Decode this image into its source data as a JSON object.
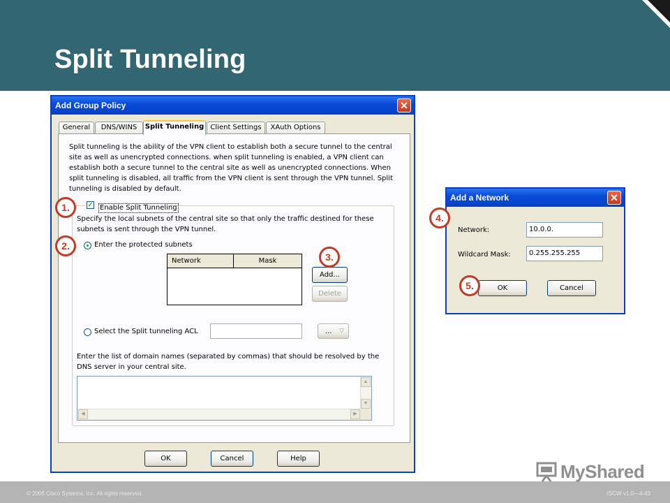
{
  "slide": {
    "title": "Split Tunneling",
    "footer_left": "© 2006 Cisco Systems, Inc. All rights reserved.",
    "footer_right": "ISCW v1.0—4-43",
    "logo_text": "MyShared",
    "colors": {
      "header": "#336673",
      "footer": "#b4b4b4",
      "marker": "#c13b26"
    }
  },
  "group_policy_dialog": {
    "title": "Add Group Policy",
    "tabs": [
      "General",
      "DNS/WINS",
      "Split Tunneling",
      "Client Settings",
      "XAuth Options"
    ],
    "active_tab": "Split Tunneling",
    "description": "Split tunneling is the ability of the VPN client to establish both a secure tunnel to the central site as well as unencrypted connections. when split tunneling is enabled, a VPN client can establish both a secure tunnel to the central site as well as unencrypted connections. When split tunneling is disabled, all traffic from the VPN client is sent through the VPN tunnel. Split tunneling is disabled by default.",
    "enable_checkbox_label": "Enable Split Tunneling",
    "enable_checked": true,
    "subnet_instructions": "Specify the local subnets of the central site so that only the traffic destined for these subnets is sent through the VPN tunnel.",
    "radio_protected": "Enter the protected subnets",
    "radio_acl": "Select the Split tunneling ACL",
    "selected_radio": "Enter the protected subnets",
    "table_headers": [
      "Network",
      "Mask"
    ],
    "add_button": "Add...",
    "delete_button": "Delete",
    "acl_dropdown_value": "...",
    "acl_input_value": "",
    "domain_instructions": "Enter the list of domain names (separated by commas) that should be resolved by the DNS server in your central site.",
    "domain_textarea_value": "",
    "ok_button": "OK",
    "cancel_button": "Cancel",
    "help_button": "Help"
  },
  "network_dialog": {
    "title": "Add a Network",
    "network_label": "Network:",
    "network_value": "10.0.0.",
    "wildcard_label": "Wildcard Mask:",
    "wildcard_value": "0.255.255.255",
    "ok_button": "OK",
    "cancel_button": "Cancel"
  },
  "markers": [
    "1.",
    "2.",
    "3.",
    "4.",
    "5."
  ]
}
